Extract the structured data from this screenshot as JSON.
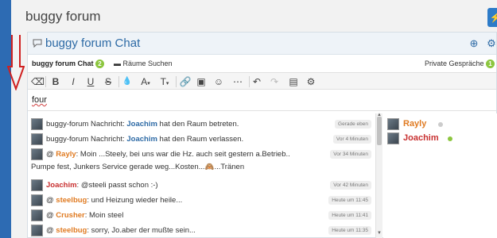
{
  "page": {
    "title": "buggy forum"
  },
  "chat": {
    "title": "buggy forum Chat",
    "tabs": {
      "active_label": "buggy forum Chat",
      "active_count": "2",
      "rooms_label": "Räume Suchen",
      "private_label": "Private Gespräche",
      "private_count": "1"
    },
    "toolbar": {
      "bold": "B",
      "italic": "I",
      "underline": "U",
      "strike": "S",
      "color": "A",
      "size": "T",
      "undo": "↶",
      "redo": "↷"
    },
    "editor": {
      "value": "four"
    },
    "messages": [
      {
        "parts": [
          "buggy-forum Nachricht: ",
          "Joachim",
          " hat den Raum betreten."
        ],
        "name_style": "blue",
        "time": "Gerade eben"
      },
      {
        "parts": [
          "buggy-forum Nachricht: ",
          "Joachim",
          " hat den Raum verlassen."
        ],
        "name_style": "blue",
        "time": "Vor 4 Minuten"
      },
      {
        "parts": [
          "@ ",
          "Rayly",
          ": Moin ...Steely, bei uns war die Hz. auch seit gestern a.Betrieb.."
        ],
        "line2": "Pumpe fest, Junkers Service gerade weg...Kosten...🙈...Tränen",
        "name_style": "orange",
        "time": "Vor 34 Minuten"
      },
      {
        "parts": [
          "",
          "Joachim",
          ": @steeli passt schon :-)"
        ],
        "name_style": "red",
        "time": "Vor 42 Minuten"
      },
      {
        "parts": [
          "@ ",
          "steelbug",
          ": und Heizung wieder heile..."
        ],
        "name_style": "orange",
        "time": "Heute um 11:45"
      },
      {
        "parts": [
          "@ ",
          "Crusher",
          ": Moin steel"
        ],
        "name_style": "orange",
        "time": "Heute um 11:41"
      },
      {
        "parts": [
          "@ ",
          "steelbug",
          ": sorry, Jo.aber der mußte sein..."
        ],
        "name_style": "orange",
        "time": "Heute um 11:35"
      }
    ],
    "users": [
      {
        "name": "Rayly",
        "color": "#e07b22",
        "status_color": "#cccccc"
      },
      {
        "name": "Joachim",
        "color": "#c83030",
        "status_color": "#8cc63f"
      }
    ]
  },
  "colors": {
    "accent": "#2d6aa5",
    "left_bar": "#2d6bb3",
    "annotation_arrow": "#d02020"
  }
}
